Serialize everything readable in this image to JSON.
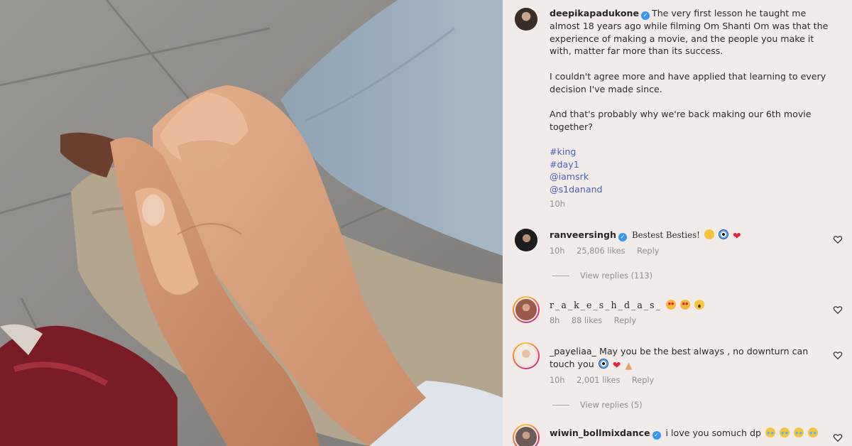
{
  "post": {
    "author": "deepikapadukone",
    "caption_p1": "The very first lesson he taught me almost 18 years ago while filming Om Shanti Om was that the experience of making a movie, and the people you make it with, matter far more than its success.",
    "caption_p2": "I couldn't agree more and have applied that learning to every decision I've made since.",
    "caption_p3": "And that's probably why we're back making our 6th movie together?",
    "hashtags": [
      "#king",
      "#day1",
      "@iamsrk",
      "@s1danand"
    ],
    "time": "10h"
  },
  "comments": [
    {
      "username": "ranveersingh",
      "verified": true,
      "text": "Bestest Besties!",
      "emojis": [
        "face-hands-icon",
        "nazar-amulet-icon",
        "red-heart-icon"
      ],
      "time": "10h",
      "likes": "25,806 likes",
      "reply": "Reply",
      "view_replies": "View replies (113)"
    },
    {
      "username": "r_a_k_e_s_h_d_a_s_",
      "verified": false,
      "text": "",
      "emojis": [
        "heart-eyes-icon",
        "heart-eyes-icon",
        "screaming-face-icon"
      ],
      "time": "8h",
      "likes": "88 likes",
      "reply": "Reply"
    },
    {
      "username": "_payeliaa_",
      "verified": false,
      "text": "May you be the best always , no downturn can touch you",
      "emojis": [
        "nazar-amulet-icon",
        "red-heart-icon",
        "folded-hands-icon"
      ],
      "time": "10h",
      "likes": "2,001 likes",
      "reply": "Reply",
      "view_replies": "View replies (5)"
    },
    {
      "username": "wiwin_bollmixdance",
      "verified": true,
      "text": "i love you somuch dp",
      "emojis": [
        "crying-face-icon",
        "crying-face-icon",
        "crying-face-icon",
        "crying-face-icon"
      ]
    }
  ],
  "colors": {
    "panel_bg": "#f1ecea",
    "hashtag": "#4a5eb5",
    "verified_badge": "#3897f0",
    "meta_text": "#8e8e8e"
  }
}
